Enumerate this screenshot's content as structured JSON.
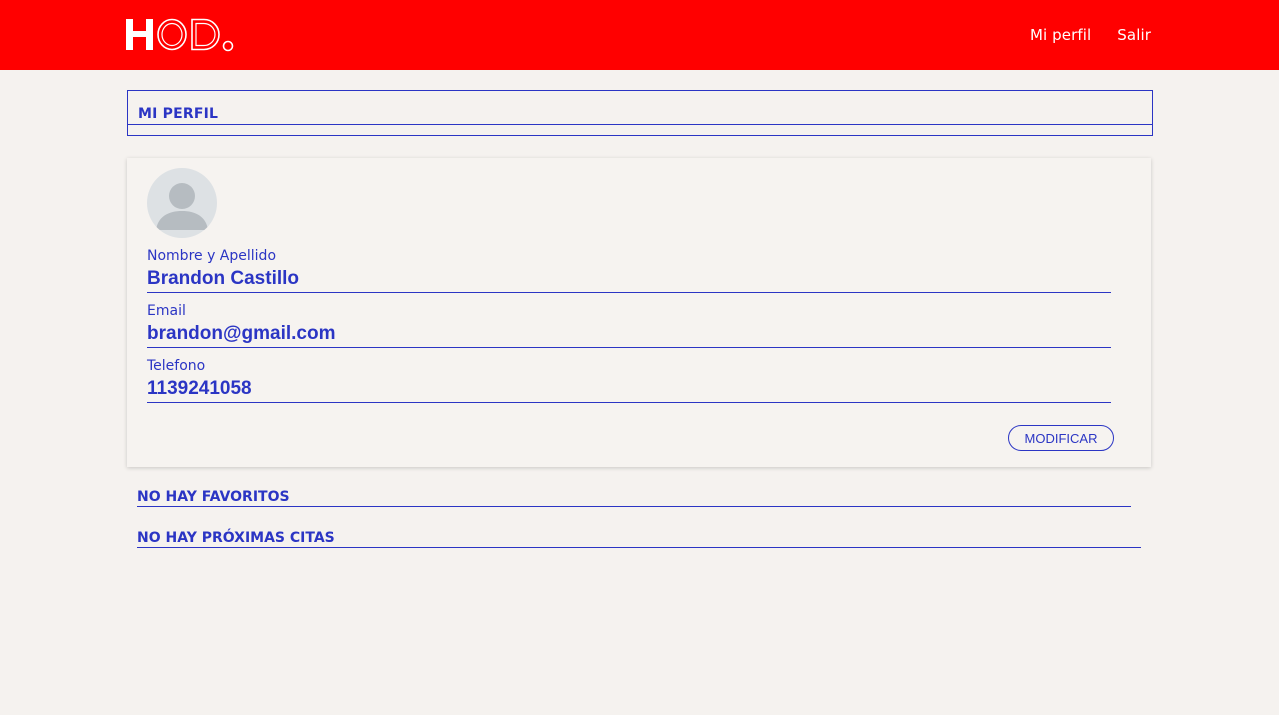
{
  "brand": {
    "logo_text": "HOD.",
    "color": "#ff0000"
  },
  "nav": {
    "profile": "Mi perfil",
    "logout": "Salir"
  },
  "page": {
    "title": "MI PERFIL"
  },
  "profile": {
    "fields": [
      {
        "label": "Nombre y Apellido",
        "value": "Brandon Castillo"
      },
      {
        "label": "Email",
        "value": "brandon@gmail.com"
      },
      {
        "label": "Telefono",
        "value": "1139241058"
      }
    ],
    "modify_label": "MODIFICAR",
    "avatar_icon": "user-silhouette-icon"
  },
  "sections": {
    "favorites_empty": "NO HAY FAVORITOS",
    "appointments_empty": "NO HAY PRÓXIMAS CITAS"
  },
  "colors": {
    "accent": "#2b35c4",
    "background": "#f5f2ef",
    "navbar": "#ff0000"
  }
}
